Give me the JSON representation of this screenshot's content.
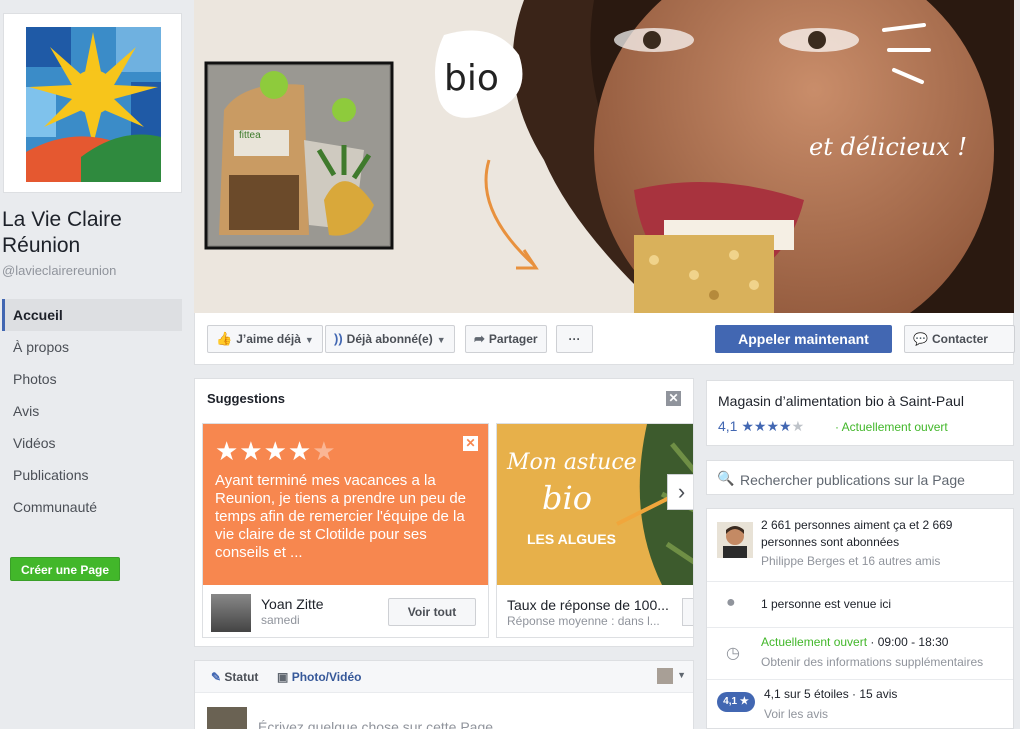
{
  "page": {
    "name": "La Vie Claire Réunion",
    "handle": "@lavieclairereunion"
  },
  "nav": {
    "items": [
      "Accueil",
      "À propos",
      "Photos",
      "Avis",
      "Vidéos",
      "Publications",
      "Communauté"
    ],
    "create_page": "Créer une Page"
  },
  "cover": {
    "bubble_text": "bio",
    "handwritten": "et délicieux !",
    "pack_label": "fittea"
  },
  "actions": {
    "like": "J’aime déjà",
    "follow": "Déjà abonné(e)",
    "share": "Partager",
    "more": "···",
    "call": "Appeler maintenant",
    "contact": "Contacter"
  },
  "suggestions": {
    "title": "Suggestions",
    "card1": {
      "stars": 4,
      "review": "Ayant terminé mes vacances a la Reunion, je tiens a prendre un peu de temps afin de remercier l'équipe de la vie claire de st Clotilde pour ses conseils et ...",
      "name": "Yoan Zitte",
      "time": "samedi",
      "button": "Voir tout"
    },
    "card2": {
      "img_line1": "Mon astuce",
      "img_line2": "bio",
      "img_line3": "LES ALGUES",
      "title": "Taux de réponse de 100...",
      "sub": "Réponse moyenne : dans l..."
    }
  },
  "composer": {
    "status": "Statut",
    "photo": "Photo/Vidéo",
    "placeholder": "Écrivez quelque chose sur cette Page..."
  },
  "about": {
    "category": "Magasin d’alimentation bio à Saint-Paul",
    "rating": "4,1",
    "stars_value": 4.1,
    "open_now": "Actuellement ouvert",
    "search_placeholder": "Rechercher publications sur la Page",
    "likes_line": "2 661 personnes aiment ça et 2 669 personnes sont abonnées",
    "friends_line": "Philippe Berges et 16 autres amis",
    "visits": "1 personne est venue ici",
    "hours_open": "Actuellement ouvert",
    "hours": " · 09:00 - 18:30",
    "more_info": "Obtenir des informations supplémentaires",
    "badge": "4,1 ★",
    "rating_text": "4,1 sur 5 étoiles · 15 avis",
    "see_reviews": "Voir les avis"
  },
  "colors": {
    "fb_blue": "#4267b2",
    "green": "#42b72a",
    "orange_card": "#f7874f"
  }
}
